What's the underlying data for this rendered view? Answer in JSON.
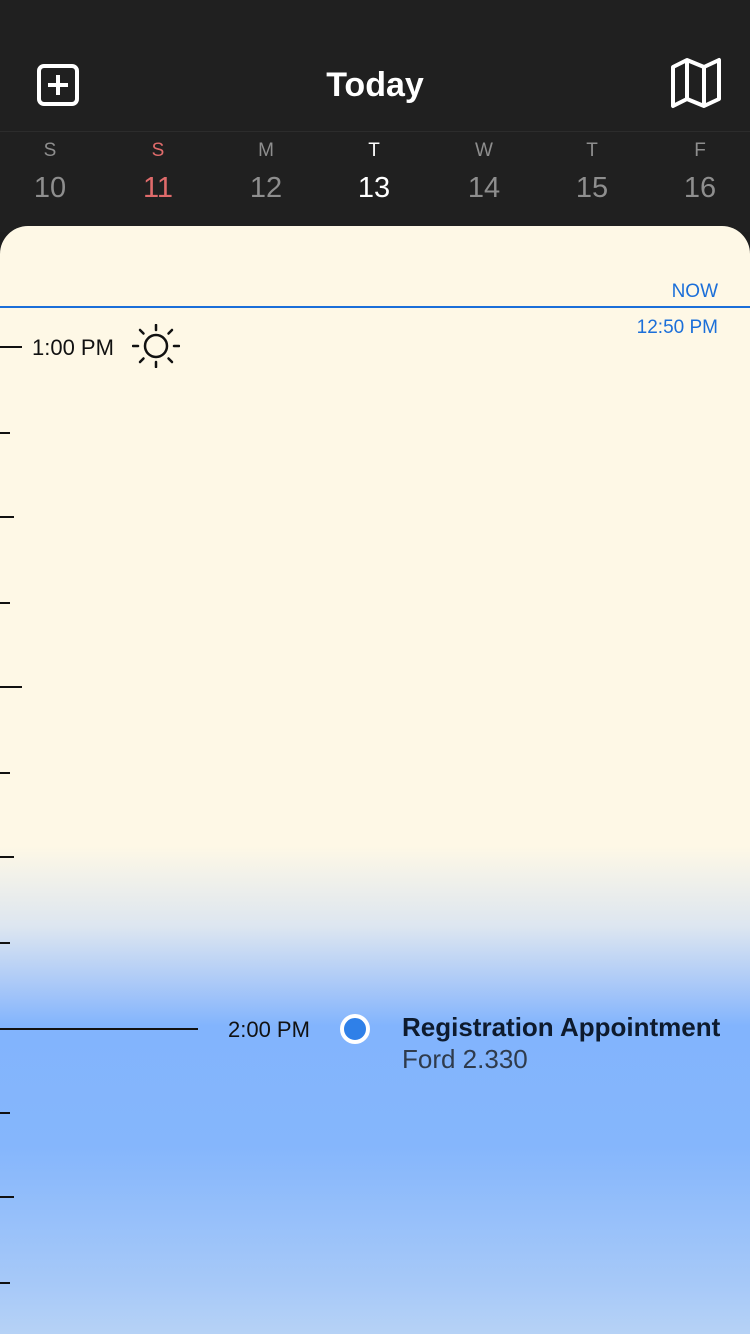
{
  "header": {
    "title": "Today",
    "add_icon": "plus-square-icon",
    "map_icon": "map-icon"
  },
  "week": {
    "days": [
      {
        "dow": "S",
        "num": "10"
      },
      {
        "dow": "S",
        "num": "11"
      },
      {
        "dow": "M",
        "num": "12"
      },
      {
        "dow": "T",
        "num": "13"
      },
      {
        "dow": "W",
        "num": "14"
      },
      {
        "dow": "T",
        "num": "15"
      },
      {
        "dow": "F",
        "num": "16"
      }
    ]
  },
  "timeline": {
    "now_label": "NOW",
    "now_time": "12:50 PM",
    "hour_1": "1:00 PM",
    "hour_2": "2:00 PM",
    "weather_icon": "sun-icon"
  },
  "event": {
    "title": "Registration Appointment",
    "location": "Ford 2.330"
  },
  "colors": {
    "accent": "#1b6fd9",
    "sunday": "#e06b6b",
    "event_dot": "#2f80e8",
    "panel": "#fef8e6"
  }
}
